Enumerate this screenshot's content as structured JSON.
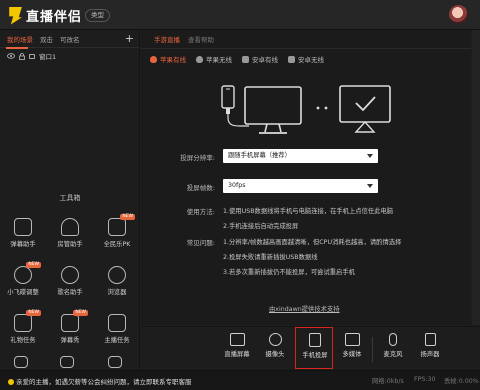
{
  "app": {
    "logo_text": "直播伴侣",
    "type_label": "类型"
  },
  "scene": {
    "tabs": [
      "我的场景",
      "双击",
      "可改名"
    ],
    "plus": "+",
    "source_label": "窗口1"
  },
  "toolbox": {
    "title": "工具箱",
    "items": [
      {
        "label": "弹幕助手",
        "icon": "danmu-assistant-icon"
      },
      {
        "label": "房管助手",
        "icon": "room-manager-icon"
      },
      {
        "label": "全民乐PK",
        "icon": "pk-icon",
        "badge": "NEW"
      },
      {
        "label": "小飞碟调整",
        "icon": "ufo-icon",
        "badge": "NEW"
      },
      {
        "label": "歌名助手",
        "icon": "song-name-icon"
      },
      {
        "label": "浏览器",
        "icon": "browser-icon"
      },
      {
        "label": "礼物任务",
        "icon": "gift-task-icon",
        "badge": "NEW"
      },
      {
        "label": "弹幕秀",
        "icon": "danmu-show-icon",
        "badge": "NEW"
      },
      {
        "label": "主播任务",
        "icon": "anchor-task-icon"
      }
    ]
  },
  "main": {
    "tabs": [
      "手游直播",
      "查看帮助"
    ],
    "device_tabs": [
      "苹果有线",
      "苹果无线",
      "安卓有线",
      "安卓无线"
    ],
    "resolution_label": "投屏分辨率:",
    "resolution_value": "跟随手机屏幕（推荐）",
    "fps_label": "投屏帧数:",
    "fps_value": "30fps",
    "usage_label": "使用方法:",
    "usage_1": "1.使用USB数据线将手机与电脑连接，在手机上点信任此电脑",
    "usage_2": "2.手机连接后自动完成投屏",
    "faq_label": "常见问题:",
    "faq_1": "1.分辨率/帧数越高画面越清晰，但CPU消耗也越高，请酌情选择",
    "faq_2": "2.投屏失败请重新插拔USB数据线",
    "faq_3": "3.若多次重新插拔仍不能投屏，可尝试重启手机",
    "support_link": "由xindawn提供技术支持"
  },
  "bottom": {
    "items": [
      "直播屏幕",
      "摄像头",
      "手机投屏",
      "多媒体",
      "麦克风",
      "扬声器"
    ]
  },
  "status": {
    "message": "亲爱的主播，如遇欠薪等公会纠纷问题，请立即联系专职客服",
    "net": "网络:0kb/s",
    "fps": "FPS:30",
    "loss": "丢帧:0.00%"
  },
  "colors": {
    "accent": "#e8643c",
    "highlight": "#d9251d",
    "logo": "#f2c600"
  }
}
